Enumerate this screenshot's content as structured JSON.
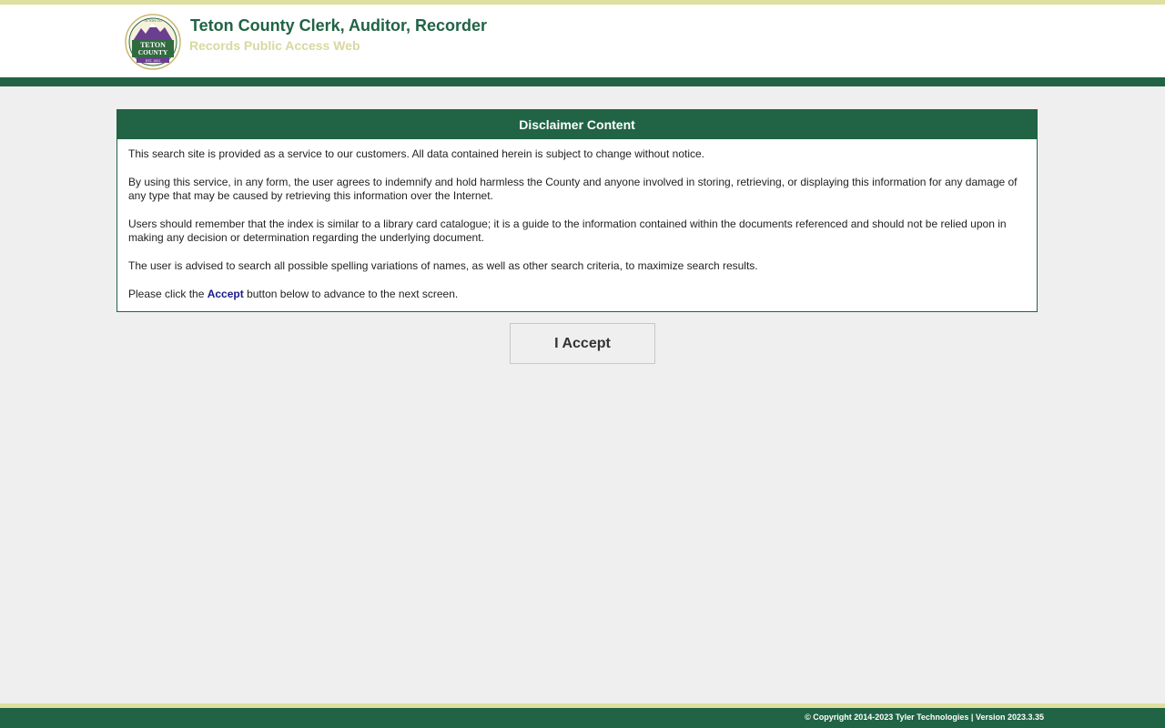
{
  "header": {
    "title": "Teton County Clerk, Auditor, Recorder",
    "subtitle": "Records Public Access Web",
    "logo": {
      "icon": "teton-county-seal-icon",
      "arc_text": "TETON CO",
      "name_line1": "TETON",
      "name_line2": "COUNTY",
      "ribbon_text": "EST. 1921"
    }
  },
  "disclaimer": {
    "heading": "Disclaimer Content",
    "paragraphs": [
      "This search site is provided as a service to our customers. All data contained herein is subject to change without notice.",
      "By using this service, in any form, the user agrees to indemnify and hold harmless the County and anyone involved in storing, retrieving, or displaying this information for any damage of any type that may be caused by retrieving this information over the Internet.",
      "Users should remember that the index is similar to a library card catalogue; it is a guide to the information contained within the documents referenced and should not be relied upon in making any decision or determination regarding the underlying document.",
      "The user is advised to search all possible spelling variations of names, as well as other search criteria, to maximize search results."
    ],
    "instruction_prefix": "Please click the ",
    "instruction_keyword": "Accept",
    "instruction_suffix": " button below to advance to the next screen."
  },
  "accept_button_label": "I Accept",
  "footer": {
    "copyright": "© Copyright 2014-2023 Tyler Technologies | Version 2023.3.35"
  },
  "colors": {
    "brand_green": "#206345",
    "accent_khaki": "#dfdf9f",
    "subtitle_khaki": "#d8d8a0",
    "link_blue": "#1a1a8c",
    "page_background": "#efefef"
  }
}
